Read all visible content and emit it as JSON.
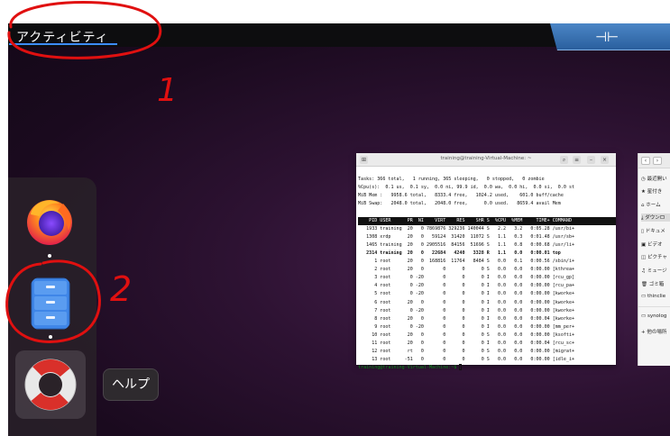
{
  "topbar": {
    "activities_label": "アクティビティ"
  },
  "dock": {
    "help_tooltip": "ヘルプ",
    "apps": [
      {
        "name": "firefox",
        "running": true
      },
      {
        "name": "files",
        "running": true
      },
      {
        "name": "help",
        "running": false
      }
    ]
  },
  "annotations": {
    "mark_1": "1",
    "mark_2": "2"
  },
  "terminal": {
    "title": "training@training-Virtual-Machine: ~",
    "summary": [
      "Tasks: 366 total,   1 running, 365 sleeping,   0 stopped,   0 zombie",
      "%Cpu(s):  0.1 us,  0.1 sy,  0.0 ni, 99.9 id,  0.0 wa,  0.0 hi,  0.0 si,  0.0 st",
      "MiB Mem :   9958.6 total,   8333.4 free,   1024.2 used,    601.0 buff/cache",
      "MiB Swap:   2048.0 total,   2048.0 free,      0.0 used.   8659.4 avail Mem"
    ],
    "header": "    PID USER      PR  NI    VIRT    RES    SHR S  %CPU  %MEM     TIME+ COMMAND ",
    "rows": [
      "   1933 training  20   0 7869876 329236 140044 S   2.2   3.2   0:05.28 /usr/bi+",
      "   1308 xrdp      20   0   59124  31420  11072 S   1.1   0.3   0:01.48 /usr/sb+",
      "   1465 training  20   0 2905516  84156  51696 S   1.1   0.8   0:00.68 /usr/li+",
      "   2314 training  20   0   22684   4240   3328 R   1.1   0.0   0:00.01 top",
      "      1 root      20   0  168816  11764   8484 S   0.0   0.1   0:00.56 /sbin/i+",
      "      2 root      20   0       0      0      0 S   0.0   0.0   0:00.00 [kthrea+",
      "      3 root       0 -20       0      0      0 I   0.0   0.0   0:00.00 [rcu_gp]",
      "      4 root       0 -20       0      0      0 I   0.0   0.0   0:00.00 [rcu_pa+",
      "      5 root       0 -20       0      0      0 I   0.0   0.0   0:00.00 [kworke+",
      "      6 root      20   0       0      0      0 I   0.0   0.0   0:00.00 [kworke+",
      "      7 root       0 -20       0      0      0 I   0.0   0.0   0:00.00 [kworke+",
      "      8 root      20   0       0      0      0 I   0.0   0.0   0:00.04 [kworke+",
      "      9 root       0 -20       0      0      0 I   0.0   0.0   0:00.00 [mm_per+",
      "     10 root      20   0       0      0      0 S   0.0   0.0   0:00.00 [ksofti+",
      "     11 root      20   0       0      0      0 I   0.0   0.0   0:00.04 [rcu_sc+",
      "     12 root      rt   0       0      0      0 S   0.0   0.0   0:00.00 [migrat+",
      "     13 root     -51   0       0      0      0 S   0.0   0.0   0:00.00 [idle_i+"
    ],
    "prompt": "training@training-Virtual-Machine:~$ "
  },
  "files_window": {
    "sidebar_items": [
      "最近開い",
      "星付き",
      "ホーム",
      "ダウンロ",
      "ドキュメ",
      "ビデオ",
      "ピクチャ",
      "ミュージ",
      "ゴミ箱",
      "thinclie",
      "synolog",
      "他の場所"
    ],
    "sidebar_icons": [
      "clock-icon",
      "star-icon",
      "home-icon",
      "download-icon",
      "document-icon",
      "video-icon",
      "picture-icon",
      "music-icon",
      "trash-icon",
      "drive-icon",
      "drive-icon",
      "plus-icon"
    ]
  },
  "colors": {
    "annotation_red": "#e01010",
    "activities_underline": "#3c8cff",
    "toolbar_blue": "#3a73b4"
  }
}
